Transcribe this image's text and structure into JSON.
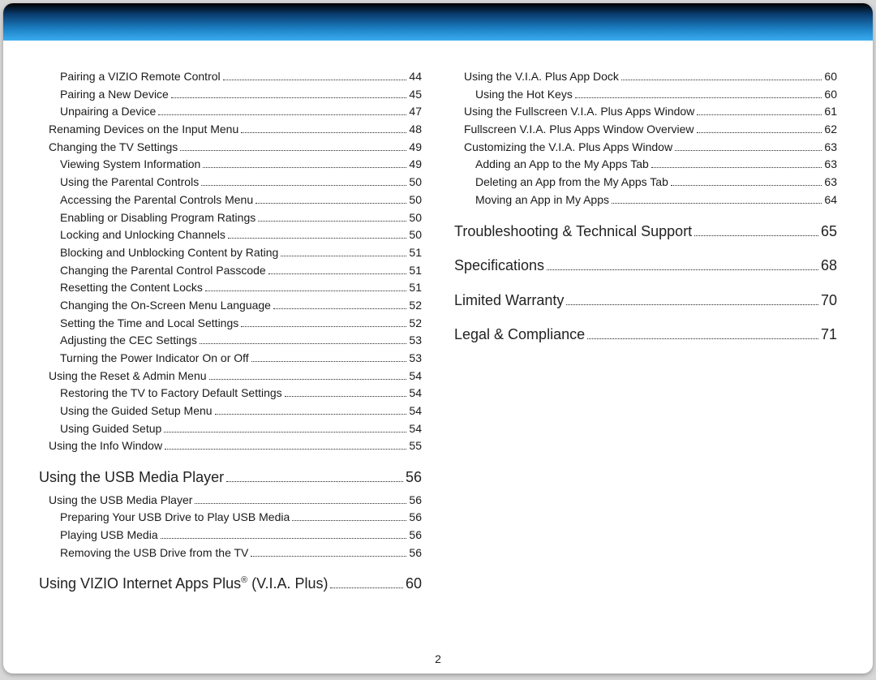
{
  "page_number": "2",
  "left": [
    {
      "lvl": 3,
      "t": "Pairing a VIZIO Remote Control",
      "p": "44"
    },
    {
      "lvl": 3,
      "t": "Pairing a New Device",
      "p": "45"
    },
    {
      "lvl": 3,
      "t": "Unpairing a Device",
      "p": "47"
    },
    {
      "lvl": 2,
      "t": "Renaming Devices on the Input Menu",
      "p": "48"
    },
    {
      "lvl": 2,
      "t": "Changing the TV Settings",
      "p": "49"
    },
    {
      "lvl": 3,
      "t": "Viewing System Information",
      "p": "49"
    },
    {
      "lvl": 3,
      "t": "Using the Parental Controls",
      "p": "50"
    },
    {
      "lvl": 3,
      "t": "Accessing the Parental Controls Menu",
      "p": "50"
    },
    {
      "lvl": 3,
      "t": "Enabling or Disabling Program Ratings",
      "p": "50"
    },
    {
      "lvl": 3,
      "t": "Locking and Unlocking Channels",
      "p": "50"
    },
    {
      "lvl": 3,
      "t": "Blocking and Unblocking Content by Rating",
      "p": "51"
    },
    {
      "lvl": 3,
      "t": "Changing the Parental Control Passcode",
      "p": "51"
    },
    {
      "lvl": 3,
      "t": "Resetting the Content Locks",
      "p": "51"
    },
    {
      "lvl": 3,
      "t": "Changing the On-Screen Menu Language",
      "p": "52"
    },
    {
      "lvl": 3,
      "t": "Setting the Time and Local Settings",
      "p": "52"
    },
    {
      "lvl": 3,
      "t": "Adjusting the CEC Settings",
      "p": "53"
    },
    {
      "lvl": 3,
      "t": "Turning the Power Indicator On or Off",
      "p": "53"
    },
    {
      "lvl": 2,
      "t": "Using the Reset & Admin Menu",
      "p": "54"
    },
    {
      "lvl": 3,
      "t": "Restoring the TV to Factory Default Settings",
      "p": "54"
    },
    {
      "lvl": 3,
      "t": "Using the Guided Setup Menu",
      "p": "54"
    },
    {
      "lvl": 3,
      "t": "Using Guided Setup",
      "p": "54"
    },
    {
      "lvl": 2,
      "t": "Using the Info Window",
      "p": "55"
    },
    {
      "lvl": 1,
      "t": "Using the USB Media Player",
      "p": "56"
    },
    {
      "lvl": 2,
      "t": "Using the USB Media Player",
      "p": "56"
    },
    {
      "lvl": 3,
      "t": "Preparing Your USB Drive to Play USB Media",
      "p": "56"
    },
    {
      "lvl": 3,
      "t": "Playing USB Media",
      "p": "56"
    },
    {
      "lvl": 3,
      "t": "Removing the USB Drive from the TV",
      "p": "56"
    },
    {
      "lvl": 1,
      "t": "Using VIZIO Internet Apps Plus® (V.I.A. Plus)",
      "p": "60"
    }
  ],
  "right": [
    {
      "lvl": 2,
      "t": "Using the V.I.A. Plus App Dock",
      "p": "60"
    },
    {
      "lvl": 3,
      "t": "Using the Hot Keys",
      "p": "60"
    },
    {
      "lvl": 2,
      "t": "Using the Fullscreen V.I.A. Plus Apps Window",
      "p": "61"
    },
    {
      "lvl": 2,
      "t": "Fullscreen V.I.A. Plus Apps Window Overview",
      "p": "62"
    },
    {
      "lvl": 2,
      "t": "Customizing the V.I.A. Plus Apps Window",
      "p": "63"
    },
    {
      "lvl": 3,
      "t": "Adding an App to the My Apps Tab",
      "p": "63"
    },
    {
      "lvl": 3,
      "t": "Deleting an App from the My Apps Tab",
      "p": "63"
    },
    {
      "lvl": 3,
      "t": "Moving an App in My Apps",
      "p": "64"
    },
    {
      "lvl": 1,
      "t": "Troubleshooting & Technical Support",
      "p": "65"
    },
    {
      "lvl": 1,
      "t": "Specifications",
      "p": "68"
    },
    {
      "lvl": 1,
      "t": "Limited Warranty",
      "p": "70"
    },
    {
      "lvl": 1,
      "t": "Legal & Compliance",
      "p": "71"
    }
  ]
}
